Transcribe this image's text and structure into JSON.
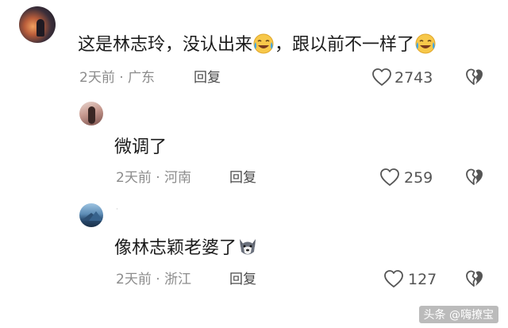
{
  "comments": [
    {
      "text_a": "这是林志玲，没认出来",
      "text_b": "，跟以前不一样了",
      "emoji": "tears-of-joy-emoji",
      "time": "2天前",
      "sep": "·",
      "location": "广东",
      "reply_label": "回复",
      "likes": "2743"
    },
    {
      "text": "微调了",
      "time": "2天前",
      "sep": "·",
      "location": "河南",
      "reply_label": "回复",
      "likes": "259"
    },
    {
      "text": "像林志颖老婆了",
      "emoji": "wolf-face-emoji",
      "username_mark": "·",
      "time": "2天前",
      "sep": "·",
      "location": "浙江",
      "reply_label": "回复",
      "likes": "127"
    }
  ],
  "watermark": {
    "source": "头条",
    "handle": "@嗨撩宝"
  },
  "icons": {
    "like": "heart-outline-icon",
    "dislike": "broken-heart-icon"
  },
  "colors": {
    "text": "#1b1b1b",
    "meta": "#8c8c8c",
    "icon": "#555555"
  }
}
